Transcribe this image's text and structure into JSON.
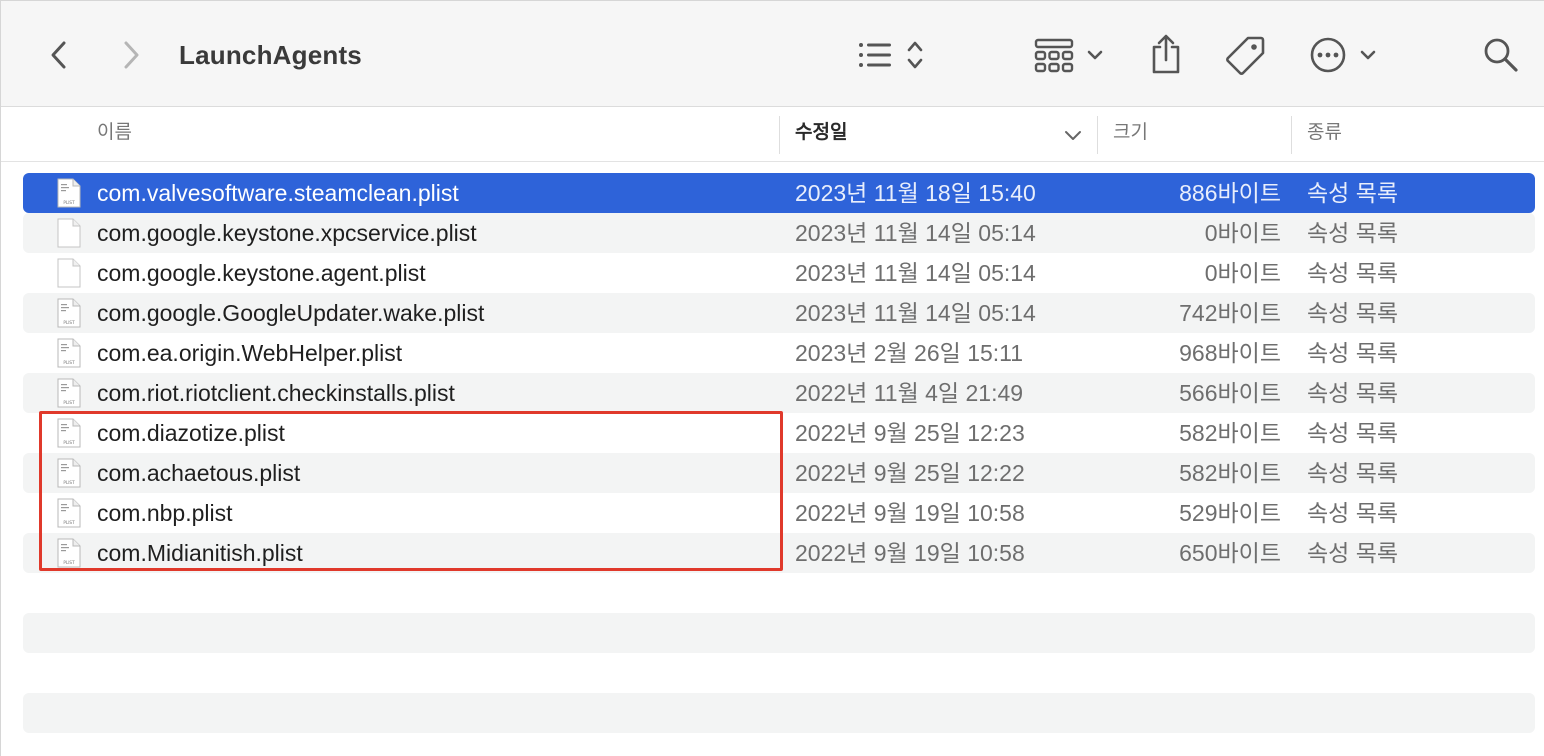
{
  "window": {
    "title": "LaunchAgents"
  },
  "toolbar": {
    "back_icon": "chevron-left-icon",
    "forward_icon": "chevron-right-icon",
    "view_icon": "list-view-icon",
    "group_icon": "grid-group-icon",
    "share_icon": "share-icon",
    "tag_icon": "tag-icon",
    "more_icon": "ellipsis-circle-icon",
    "search_icon": "search-icon"
  },
  "columns": {
    "name": "이름",
    "modified": "수정일",
    "size": "크기",
    "kind": "종류"
  },
  "files": [
    {
      "name": "com.valvesoftware.steamclean.plist",
      "date": "2023년 11월 18일 15:40",
      "size": "886바이트",
      "kind": "속성 목록",
      "icon": "plist-file-icon",
      "selected": true
    },
    {
      "name": "com.google.keystone.xpcservice.plist",
      "date": "2023년 11월 14일 05:14",
      "size": "0바이트",
      "kind": "속성 목록",
      "icon": "blank-file-icon"
    },
    {
      "name": "com.google.keystone.agent.plist",
      "date": "2023년 11월 14일 05:14",
      "size": "0바이트",
      "kind": "속성 목록",
      "icon": "blank-file-icon"
    },
    {
      "name": "com.google.GoogleUpdater.wake.plist",
      "date": "2023년 11월 14일 05:14",
      "size": "742바이트",
      "kind": "속성 목록",
      "icon": "plist-file-icon"
    },
    {
      "name": "com.ea.origin.WebHelper.plist",
      "date": "2023년 2월 26일 15:11",
      "size": "968바이트",
      "kind": "속성 목록",
      "icon": "plist-file-icon"
    },
    {
      "name": "com.riot.riotclient.checkinstalls.plist",
      "date": "2022년 11월 4일 21:49",
      "size": "566바이트",
      "kind": "속성 목록",
      "icon": "plist-file-icon"
    },
    {
      "name": "com.diazotize.plist",
      "date": "2022년 9월 25일 12:23",
      "size": "582바이트",
      "kind": "속성 목록",
      "icon": "plist-file-icon"
    },
    {
      "name": "com.achaetous.plist",
      "date": "2022년 9월 25일 12:22",
      "size": "582바이트",
      "kind": "속성 목록",
      "icon": "plist-file-icon"
    },
    {
      "name": "com.nbp.plist",
      "date": "2022년 9월 19일 10:58",
      "size": "529바이트",
      "kind": "속성 목록",
      "icon": "plist-file-icon"
    },
    {
      "name": "com.Midianitish.plist",
      "date": "2022년 9월 19일 10:58",
      "size": "650바이트",
      "kind": "속성 목록",
      "icon": "plist-file-icon"
    }
  ],
  "colors": {
    "selection": "#2e63d9",
    "highlight_box": "#e0392b",
    "stripe": "#f3f4f4"
  }
}
